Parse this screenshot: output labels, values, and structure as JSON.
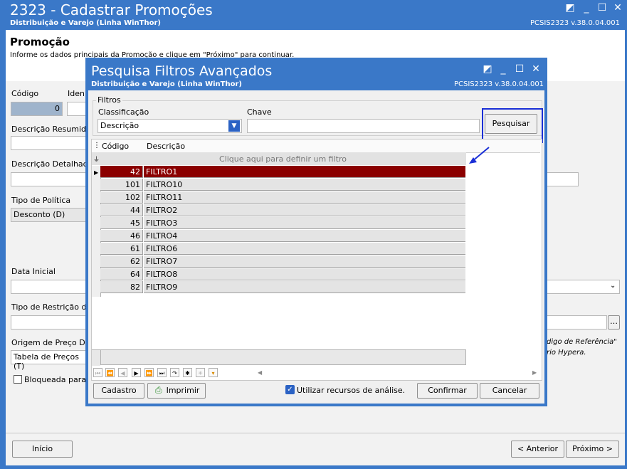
{
  "main": {
    "title": "2323 - Cadastrar Promoções",
    "subtitle": "Distribuição e Varejo (Linha WinThor)",
    "version": "PCSIS2323  v.38.0.04.001",
    "page_heading": "Promoção",
    "page_desc": "Informe os dados principais da Promoção e clique em \"Próximo\" para continuar.",
    "codigo_label": "Código",
    "ident_label": "Iden",
    "codigo_value": "0",
    "desc_resumida_label": "Descrição Resumida",
    "desc_detalhada_label": "Descrição Detalhada",
    "tipo_politica_label": "Tipo de Política",
    "tipo_politica_value": "Desconto (D)",
    "data_inicial_label": "Data Inicial",
    "tipo_restricao_label": "Tipo de Restrição de C",
    "origem_preco_label": "Origem de Preço Difer",
    "origem_preco_value": "Tabela de Preços (T)",
    "bloqueada_label": "Bloqueada para V",
    "right_text_1": "digo de Referência\"",
    "right_text_2": "rio Hypera.",
    "inicio_label": "Início",
    "anterior_label": "< Anterior",
    "proximo_label": "Próximo >"
  },
  "dialog": {
    "title": "Pesquisa Filtros Avançados",
    "subtitle": "Distribuição e Varejo (Linha WinThor)",
    "version": "PCSIS2323  v.38.0.04.001",
    "group_label": "Filtros",
    "classificacao_label": "Classificação",
    "classificacao_value": "Descrição",
    "chave_label": "Chave",
    "pesquisar_label": "Pesquisar",
    "col_codigo": "Código",
    "col_descricao": "Descrição",
    "filter_hint": "Clique aqui para definir um filtro",
    "rows": [
      {
        "codigo": "42",
        "descricao": "FILTRO1"
      },
      {
        "codigo": "101",
        "descricao": "FILTRO10"
      },
      {
        "codigo": "102",
        "descricao": "FILTRO11"
      },
      {
        "codigo": "44",
        "descricao": "FILTRO2"
      },
      {
        "codigo": "45",
        "descricao": "FILTRO3"
      },
      {
        "codigo": "46",
        "descricao": "FILTRO4"
      },
      {
        "codigo": "61",
        "descricao": "FILTRO6"
      },
      {
        "codigo": "62",
        "descricao": "FILTRO7"
      },
      {
        "codigo": "64",
        "descricao": "FILTRO8"
      },
      {
        "codigo": "82",
        "descricao": "FILTRO9"
      }
    ],
    "cadastro_label": "Cadastro",
    "imprimir_label": "Imprimir",
    "analise_label": "Utilizar recursos de análise.",
    "confirmar_label": "Confirmar",
    "cancelar_label": "Cancelar"
  },
  "colors": {
    "titlebar": "#3a78c8",
    "selected_row": "#8b0000",
    "highlight_box": "#1a2fd6"
  }
}
